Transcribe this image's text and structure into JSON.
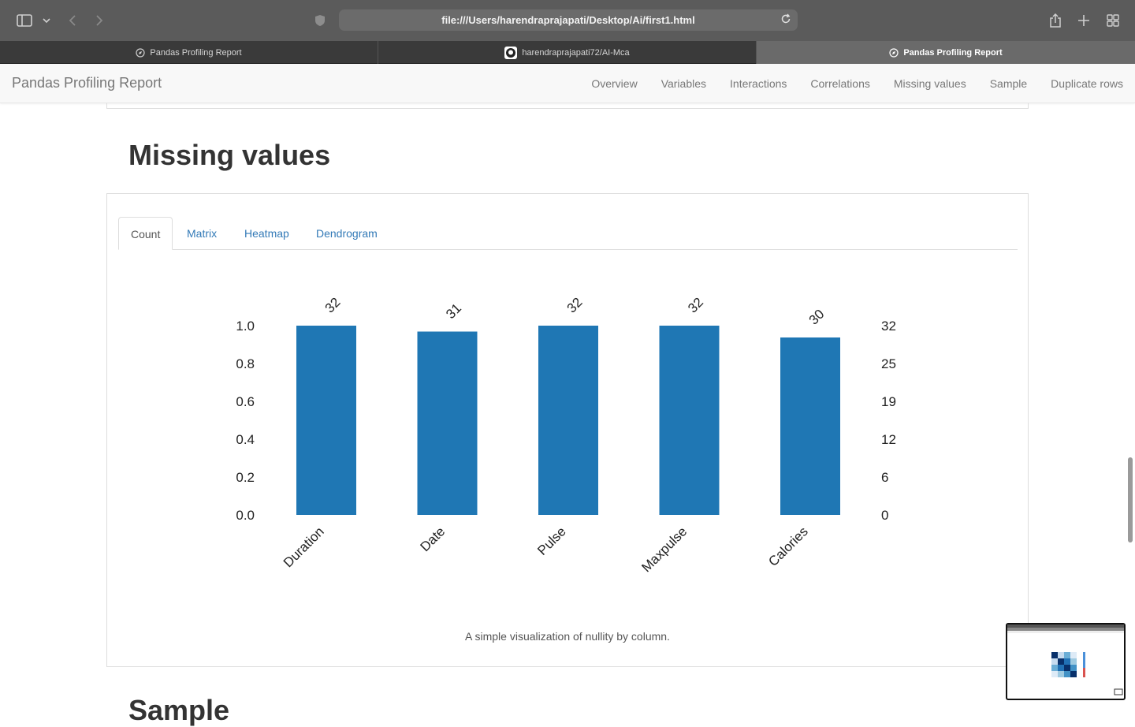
{
  "browser": {
    "url": "file:///Users/harendraprajapati/Desktop/Ai/first1.html",
    "tabs": [
      {
        "label": "Pandas Profiling Report",
        "active": false
      },
      {
        "label": "harendraprajapati72/AI-Mca",
        "active": false
      },
      {
        "label": "Pandas Profiling Report",
        "active": true
      }
    ]
  },
  "navbar": {
    "brand": "Pandas Profiling Report",
    "links": [
      "Overview",
      "Variables",
      "Interactions",
      "Correlations",
      "Missing values",
      "Sample",
      "Duplicate rows"
    ]
  },
  "section": {
    "title": "Missing values",
    "tabs": [
      "Count",
      "Matrix",
      "Heatmap",
      "Dendrogram"
    ],
    "caption": "A simple visualization of nullity by column.",
    "next_title": "Sample"
  },
  "chart_data": {
    "type": "bar",
    "categories": [
      "Duration",
      "Date",
      "Pulse",
      "Maxpulse",
      "Calories"
    ],
    "values": [
      32,
      31,
      32,
      32,
      30
    ],
    "data_labels": [
      "32",
      "31",
      "32",
      "32",
      "30"
    ],
    "y_left_ticks": [
      "0.0",
      "0.2",
      "0.4",
      "0.6",
      "0.8",
      "1.0"
    ],
    "y_right_ticks": [
      "0",
      "6",
      "12",
      "19",
      "25",
      "32"
    ],
    "ylim": [
      0,
      32
    ],
    "color": "#1f77b4",
    "grid": false
  }
}
